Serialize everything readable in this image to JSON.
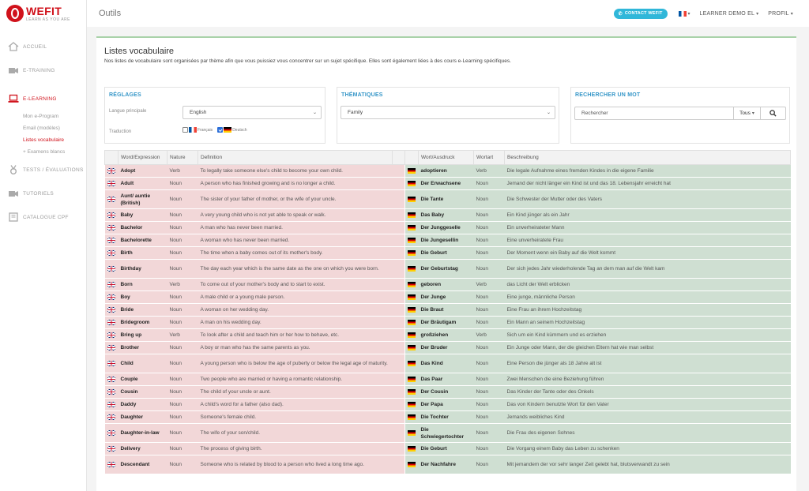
{
  "brand": {
    "name": "WEFIT",
    "tagline": "LEARN AS YOU ARE"
  },
  "sidebar": {
    "items": [
      {
        "label": "ACCUEIL",
        "icon": "home-icon"
      },
      {
        "label": "E-TRAINING",
        "icon": "video-camera-icon"
      },
      {
        "label": "E-LEARNING",
        "icon": "laptop-icon",
        "active": true
      },
      {
        "label": "TESTS / ÉVALUATIONS",
        "icon": "medal-icon"
      },
      {
        "label": "TUTORIELS",
        "icon": "video-camera-icon"
      },
      {
        "label": "CATALOGUE CPF",
        "icon": "book-icon"
      }
    ],
    "subitems": [
      "Mon e-Program",
      "Email (modèles)",
      "Listes vocabulaire",
      "+ Examens blancs"
    ]
  },
  "topbar": {
    "title": "Outils",
    "contact": "CONTACT WEFIT",
    "user": "LEARNER DEMO EL",
    "profile": "PROFIL"
  },
  "page": {
    "title": "Listes vocabulaire",
    "description": "Nos listes de vocabulaire sont organisées par thème afin que vous puissiez vous concentrer sur un sujet spécifique. Elles sont également liées à des cours e-Learning spécifiques."
  },
  "settings": {
    "heading": "RÉGLAGES",
    "language_label": "Langue principale",
    "language_value": "English",
    "translation_label": "Traduction",
    "options": [
      {
        "label": "Français",
        "checked": false
      },
      {
        "label": "Deutsch",
        "checked": true
      }
    ]
  },
  "themes": {
    "heading": "THÉMATIQUES",
    "value": "Family"
  },
  "search": {
    "heading": "RECHERCHER UN MOT",
    "placeholder": "Rechercher",
    "filter": "Tous"
  },
  "colors": {
    "accent_red": "#d0121b",
    "heading_blue": "#3596c8",
    "english_bg": "#f2d7d8",
    "german_bg": "#cfdfd2",
    "contact_btn": "#30b7d9"
  },
  "table": {
    "headers_en": [
      "Word/Expression",
      "Nature",
      "Definition"
    ],
    "headers_de": [
      "Wort/Ausdruck",
      "Wortart",
      "Beschreibung"
    ],
    "rows": [
      [
        "Adopt",
        "Verb",
        "To legally take someone else's child to become your own child.",
        "adoptieren",
        "Verb",
        "Die legale Aufnahme eines fremden Kindes in die eigene Familie"
      ],
      [
        "Adult",
        "Noun",
        "A person who has finished growing and is no longer a child.",
        "Der Erwachsene",
        "Noun",
        "Jemand der nicht länger ein Kind ist und das 18. Lebensjahr erreicht hat"
      ],
      [
        "Aunt/ auntie (British)",
        "Noun",
        "The sister of your father of mother, or the wife of your uncle.",
        "Die Tante",
        "Noun",
        "Die Schwester der Mutter oder des Vaters"
      ],
      [
        "Baby",
        "Noun",
        "A very young child who is not yet able to speak or walk.",
        "Das Baby",
        "Noun",
        "Ein Kind jünger als ein Jahr"
      ],
      [
        "Bachelor",
        "Noun",
        "A man who has never been married.",
        "Der Junggeselle",
        "Noun",
        "Ein unverheirateter Mann"
      ],
      [
        "Bachelorette",
        "Noun",
        "A woman who has never been married.",
        "Die Jungesellin",
        "Noun",
        "Eine unverheiratete Frau"
      ],
      [
        "Birth",
        "Noun",
        "The time when a baby comes out of its mother's body.",
        "Die Geburt",
        "Noun",
        "Der Moment wenn ein Baby auf die Welt kommt"
      ],
      [
        "Birthday",
        "Noun",
        "The day each year which is the same date as the one on which you were born.",
        "Der Geburtstag",
        "Noun",
        "Der sich jedes Jahr wiederholende Tag an dem man auf die Welt kam"
      ],
      [
        "Born",
        "Verb",
        "To come out of your mother's body and to start to exist.",
        "geboren",
        "Verb",
        "das Licht der Welt erblicken"
      ],
      [
        "Boy",
        "Noun",
        "A male child or a young male person.",
        "Der Junge",
        "Noun",
        "Eine junge, männliche Person"
      ],
      [
        "Bride",
        "Noun",
        "A woman on her wedding day.",
        "Die Braut",
        "Noun",
        "Eine Frau an ihrem Hochzeitstag"
      ],
      [
        "Bridegroom",
        "Noun",
        "A man on his wedding day.",
        "Der Bräutigam",
        "Noun",
        "Ein Mann an seinem Hochzeitstag"
      ],
      [
        "Bring up",
        "Verb",
        "To look after a child and teach him or her how to behave, etc.",
        "großziehen",
        "Verb",
        "Sich um ein Kind kümmern und es erziehen"
      ],
      [
        "Brother",
        "Noun",
        "A boy or man who has the same parents as you.",
        "Der Bruder",
        "Noun",
        "Ein Junge oder Mann, der die gleichen Eltern hat wie man selbst"
      ],
      [
        "Child",
        "Noun",
        "A young person who is below the age of puberty or below the legal age of maturity.",
        "Das Kind",
        "Noun",
        "Eine Person die jünger als 18 Jahre alt ist"
      ],
      [
        "Couple",
        "Noun",
        "Two people who are married or having a romantic relationship.",
        "Das Paar",
        "Noun",
        "Zwei Menschen die eine Beziehung führen"
      ],
      [
        "Cousin",
        "Noun",
        "The child of your uncle or aunt.",
        "Der Cousin",
        "Noun",
        "Das Kinder der Tante oder des Onkels"
      ],
      [
        "Daddy",
        "Noun",
        "A child's word for a father (also dad).",
        "Der Papa",
        "Noun",
        "Das von Kindern benutzte Wort für den Vater"
      ],
      [
        "Daughter",
        "Noun",
        "Someone's female child.",
        "Die Tochter",
        "Noun",
        "Jemands weibliches Kind"
      ],
      [
        "Daughter-in-law",
        "Noun",
        "The wife of your son/child.",
        "Die Schwiegertochter",
        "Noun",
        "Die Frau des eigenen Sohnes"
      ],
      [
        "Delivery",
        "Noun",
        "The process of giving birth.",
        "Die Geburt",
        "Noun",
        "Die Vorgang einem Baby das Leben zu schenken"
      ],
      [
        "Descendant",
        "Noun",
        "Someone who is related by blood to a person who lived a long time ago.",
        "Der Nachfahre",
        "Noun",
        "Mit jemandem der vor sehr langer Zeit gelebt hat, blutsverwandt zu sein"
      ]
    ]
  }
}
